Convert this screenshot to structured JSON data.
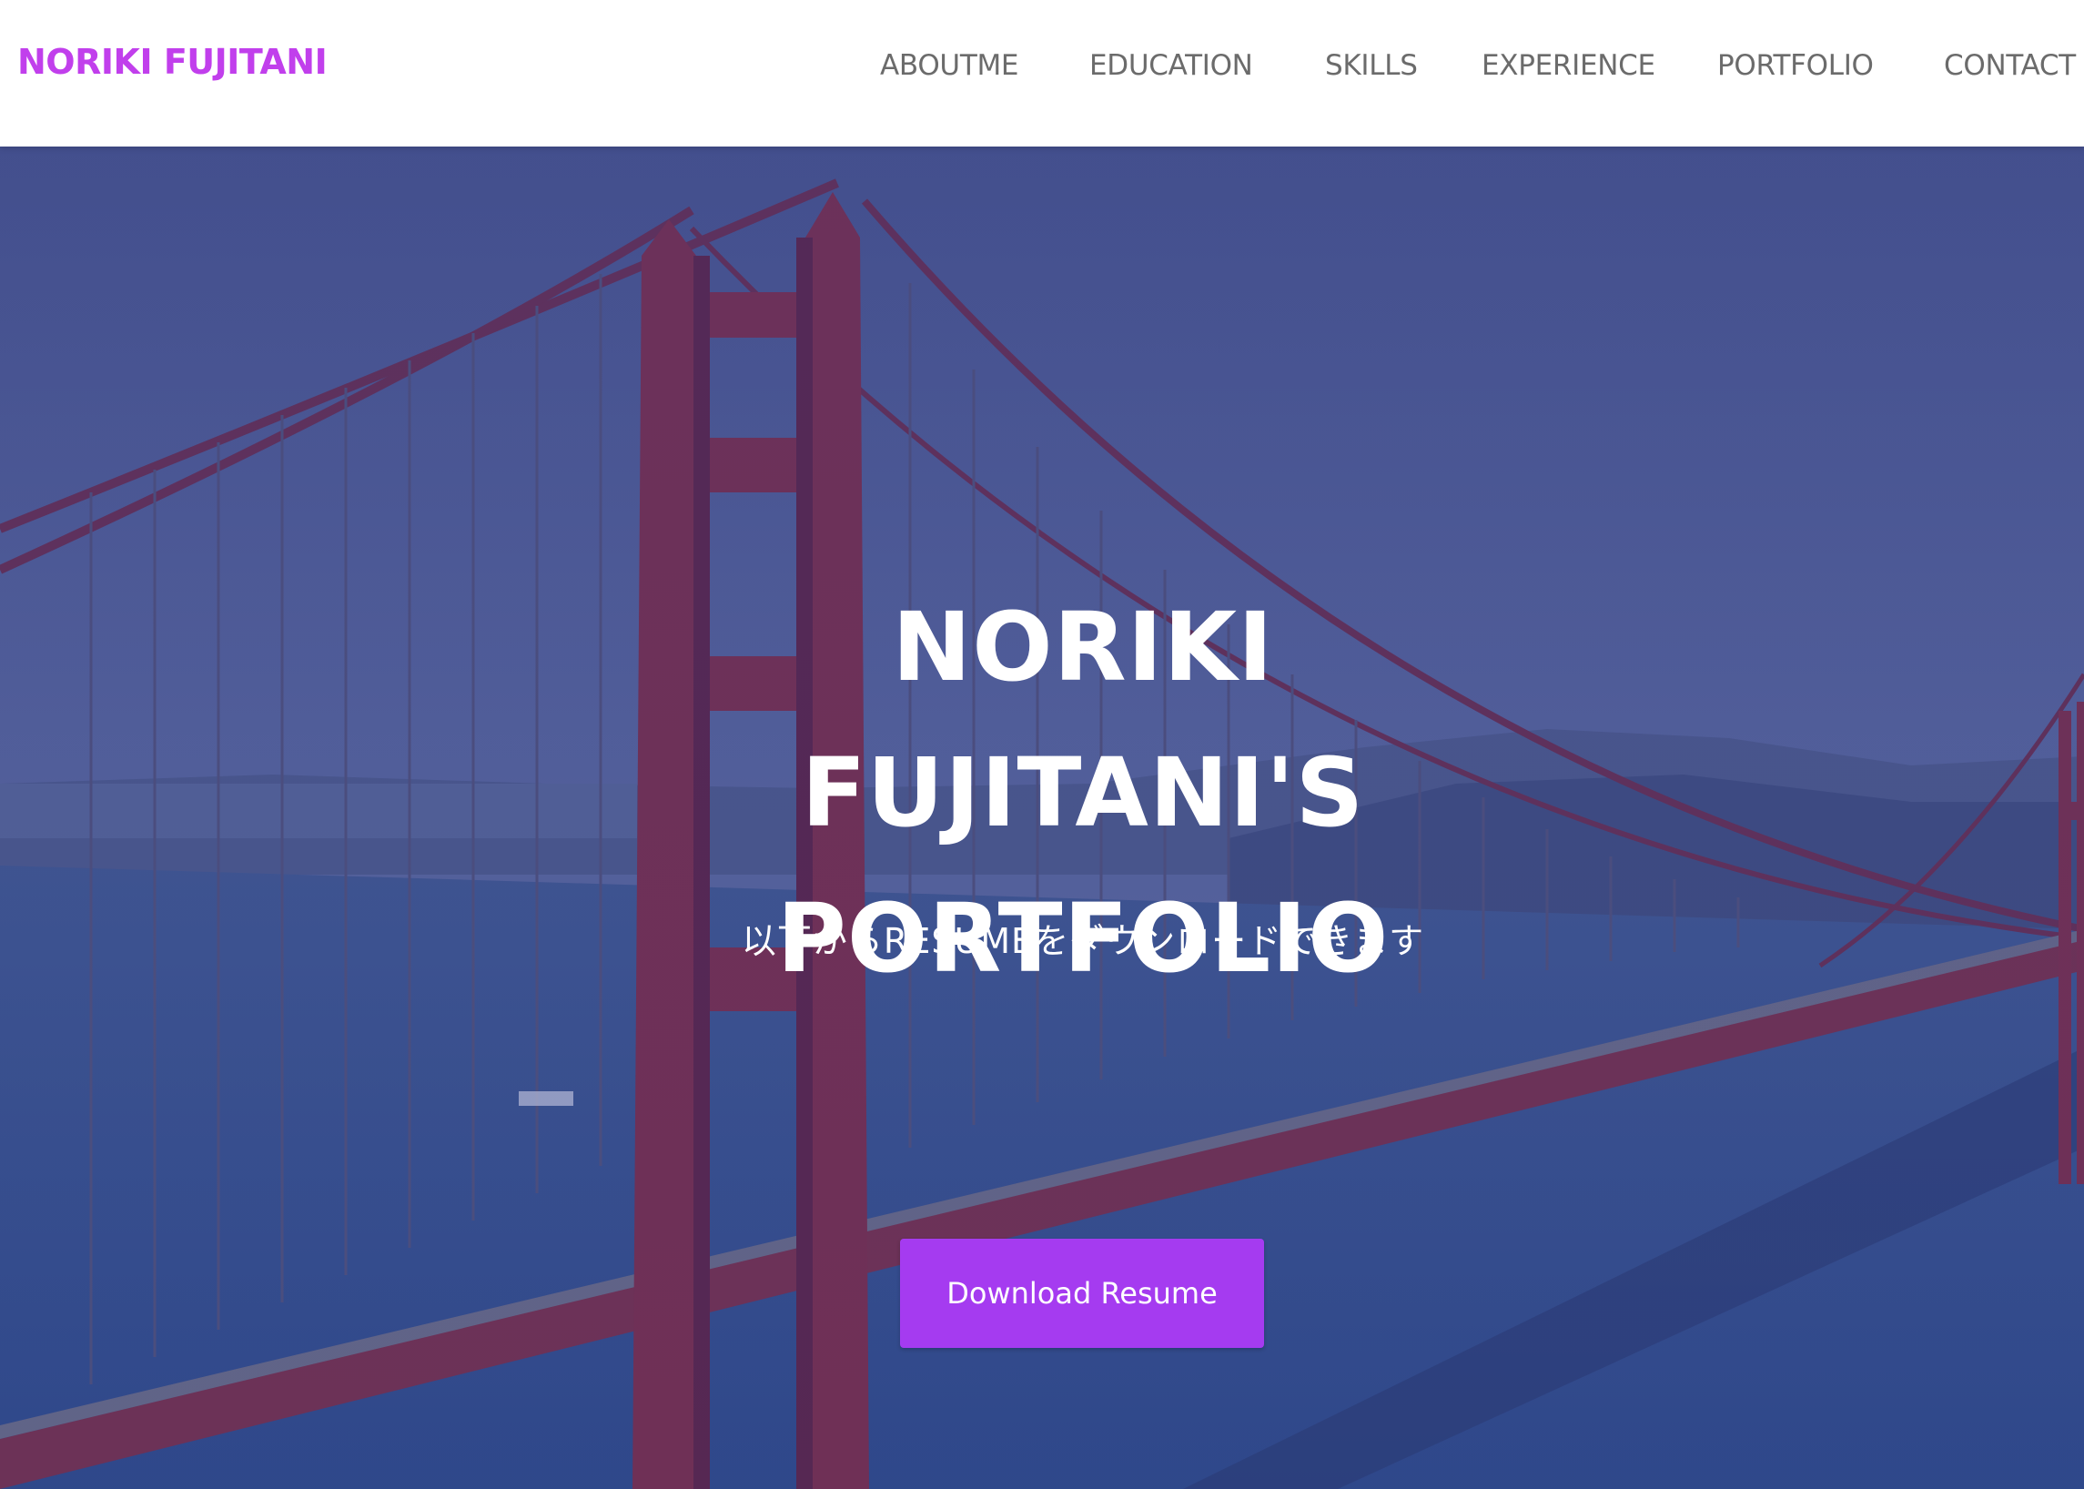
{
  "navbar": {
    "brand": "NORIKI FUJITANI",
    "links": [
      {
        "label": "ABOUTME"
      },
      {
        "label": "EDUCATION"
      },
      {
        "label": "SKILLS"
      },
      {
        "label": "EXPERIENCE"
      },
      {
        "label": "PORTFOLIO"
      },
      {
        "label": "CONTACT"
      }
    ]
  },
  "hero": {
    "title_lines": [
      "NORIKI",
      "FUJITANI'S",
      "PORTFOLIO"
    ],
    "subtitle": "以下からRESUMEをダウンロードできます",
    "button_label": "Download Resume",
    "background": "golden-gate-bridge-photo"
  },
  "colors": {
    "brand": "#c13fec",
    "nav_text": "#6b6b6b",
    "button": "#a53bf0",
    "overlay": "#3b3f8c",
    "bridge": "#8a2d45"
  }
}
